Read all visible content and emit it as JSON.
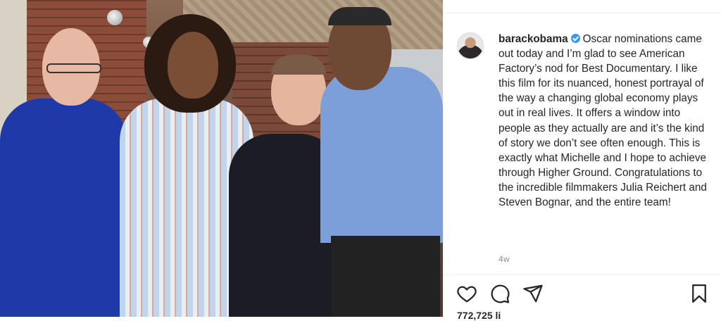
{
  "post": {
    "username": "barackobama",
    "caption": "Oscar nominations came out today and I’m glad to see American Factory’s nod for Best Documentary. I like this film for its nuanced, honest portrayal of the way a changing global economy plays out in real lives. It offers a window into people as they actually are and it’s the kind of story we don’t see often enough. This is exactly what Michelle and I hope to achieve through Higher Ground. Congratulations to the incredible filmmakers Julia Reichert and Steven Bognar, and the entire team!",
    "timestamp": "4w",
    "likes": "772,725 li"
  },
  "icons": {
    "like": "heart-icon",
    "comment": "comment-icon",
    "share": "paper-plane-icon",
    "save": "bookmark-icon",
    "verified": "verified-badge-icon"
  },
  "colors": {
    "verified": "#3897f0",
    "text": "#262626",
    "muted": "#8e8e8e"
  }
}
